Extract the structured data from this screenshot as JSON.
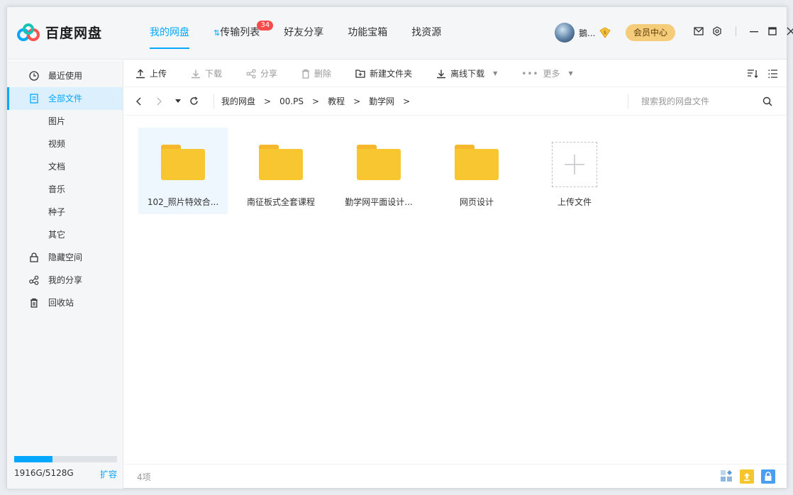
{
  "app": {
    "name": "百度网盘"
  },
  "nav": [
    {
      "label": "我的网盘",
      "active": true
    },
    {
      "label": "传输列表",
      "badge": "34"
    },
    {
      "label": "好友分享"
    },
    {
      "label": "功能宝箱"
    },
    {
      "label": "找资源"
    }
  ],
  "user": {
    "name": "鵝...",
    "member_label": "会员中心"
  },
  "sidebar": {
    "items": [
      {
        "label": "最近使用",
        "icon": "clock-icon"
      },
      {
        "label": "全部文件",
        "icon": "document-icon",
        "active": true
      },
      {
        "label": "图片"
      },
      {
        "label": "视频"
      },
      {
        "label": "文档"
      },
      {
        "label": "音乐"
      },
      {
        "label": "种子"
      },
      {
        "label": "其它"
      },
      {
        "label": "隐藏空间",
        "icon": "lock-icon"
      },
      {
        "label": "我的分享",
        "icon": "share-icon"
      },
      {
        "label": "回收站",
        "icon": "trash-icon"
      }
    ],
    "storage": {
      "used_text": "1916G/5128G",
      "used_fraction": 0.3736,
      "expand_label": "扩容"
    }
  },
  "toolbar": {
    "upload": "上传",
    "download": "下载",
    "share": "分享",
    "delete": "删除",
    "new_folder": "新建文件夹",
    "offline_download": "离线下载",
    "more": "更多"
  },
  "path": {
    "crumbs": [
      "我的网盘",
      "00.PS",
      "教程",
      "勤学网"
    ],
    "search_placeholder": "搜索我的网盘文件"
  },
  "files": [
    {
      "name": "102_照片特效合...",
      "selected": true
    },
    {
      "name": "南征板式全套课程"
    },
    {
      "name": "勤学网平面设计..."
    },
    {
      "name": "网页设计"
    }
  ],
  "upload_tile": {
    "label": "上传文件"
  },
  "status": {
    "count_text": "4项"
  },
  "colors": {
    "accent": "#06a7ff",
    "folder": "#f8c630",
    "badge": "#f74b4b",
    "member": "#f5cc7a"
  }
}
